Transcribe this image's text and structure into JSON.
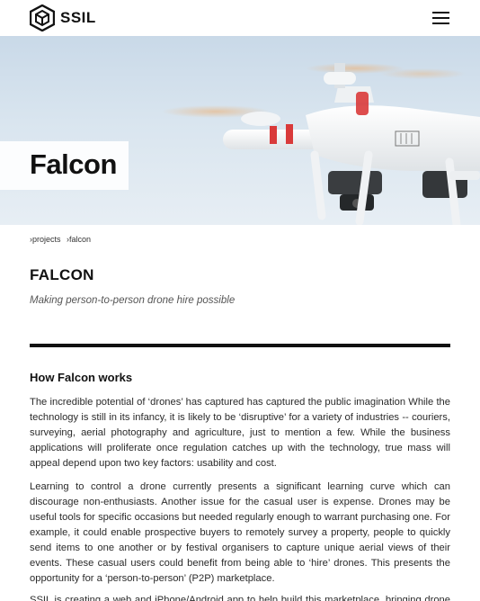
{
  "header": {
    "brand": "SSIL",
    "logo_icon": "cube-logo-icon",
    "menu_icon": "hamburger-menu-icon"
  },
  "hero": {
    "title": "Falcon",
    "image": "drone-photo"
  },
  "breadcrumb": {
    "items": [
      "›projects",
      "›falcon"
    ]
  },
  "project": {
    "title": "FALCON",
    "subtitle": "Making person-to-person drone hire possible"
  },
  "section": {
    "heading": "How Falcon works",
    "paragraphs": [
      "The incredible potential of ‘drones’ has captured has captured the public imagination While the technology is still in its infancy, it is likely to be ‘disruptive’ for a variety of industries -- couriers, surveying, aerial photography and agriculture, just to mention a few. While the business applications will proliferate once regulation catches up with the technology, true mass will appeal depend upon two key factors: usability and cost.",
      "Learning to control a drone currently presents a significant learning curve which can discourage non-enthusiasts. Another issue for the casual user is expense. Drones may be useful tools for specific occasions but needed regularly enough to warrant purchasing one. For example, it could enable prospective buyers to remotely survey a property, people to quickly send items to one another or by festival organisers to capture unique aerial views of their events. These casual users could benefit from being able to ‘hire’ drones. This presents the opportunity for a ‘person-to-person’ (P2P) marketplace.",
      "SSIL is creating a web and iPhone/Android app to help build this marketplace, bringing drone hirers and owners together."
    ]
  },
  "colors": {
    "text": "#1a1a1a",
    "rule": "#111111",
    "sky": "#d9e5ef",
    "drone_accent": "#d93a3a"
  }
}
